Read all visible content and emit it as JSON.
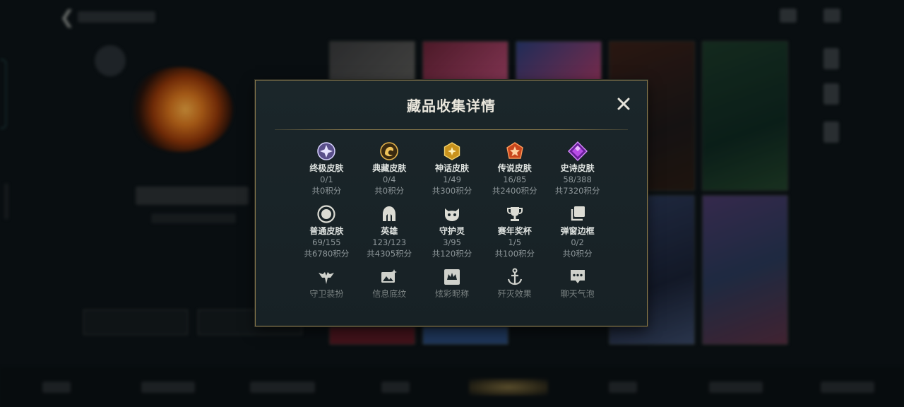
{
  "modal": {
    "title": "藏品收集详情",
    "close_label": "✕"
  },
  "categories": [
    {
      "icon": "ultimate-skin-icon",
      "label": "终极皮肤",
      "count": "0/1",
      "points": "共0积分",
      "color": "#b7a8ff"
    },
    {
      "icon": "prestige-skin-icon",
      "label": "典藏皮肤",
      "count": "0/4",
      "points": "共0积分",
      "color": "#d9a53a"
    },
    {
      "icon": "mythic-skin-icon",
      "label": "神话皮肤",
      "count": "1/49",
      "points": "共300积分",
      "color": "#e8b634"
    },
    {
      "icon": "legendary-skin-icon",
      "label": "传说皮肤",
      "count": "16/85",
      "points": "共2400积分",
      "color": "#e0642a"
    },
    {
      "icon": "epic-skin-icon",
      "label": "史诗皮肤",
      "count": "58/388",
      "points": "共7320积分",
      "color": "#b84ce6"
    },
    {
      "icon": "normal-skin-icon",
      "label": "普通皮肤",
      "count": "69/155",
      "points": "共6780积分",
      "color": "#d6d6d0"
    },
    {
      "icon": "helmet-icon",
      "label": "英雄",
      "count": "123/123",
      "points": "共4305积分",
      "color": "#d6d6d0"
    },
    {
      "icon": "ward-pet-icon",
      "label": "守护灵",
      "count": "3/95",
      "points": "共120积分",
      "color": "#d6d6d0"
    },
    {
      "icon": "trophy-icon",
      "label": "赛年奖杯",
      "count": "1/5",
      "points": "共100积分",
      "color": "#d6d6d0"
    },
    {
      "icon": "frame-icon",
      "label": "弹窗边框",
      "count": "0/2",
      "points": "共0积分",
      "color": "#d6d6d0"
    },
    {
      "icon": "ward-skin-icon",
      "label": "守卫装扮",
      "color": "#c9cbc6"
    },
    {
      "icon": "banner-image-icon",
      "label": "信息底纹",
      "color": "#c9cbc6"
    },
    {
      "icon": "title-icon",
      "label": "炫彩昵称",
      "color": "#c9cbc6"
    },
    {
      "icon": "anchor-icon",
      "label": "歼灭效果",
      "color": "#c9cbc6"
    },
    {
      "icon": "chat-bubble-icon",
      "label": "聊天气泡",
      "color": "#c9cbc6"
    }
  ],
  "colors": {
    "accent_gold": "#8b7a4c",
    "panel": "#1b262a"
  }
}
